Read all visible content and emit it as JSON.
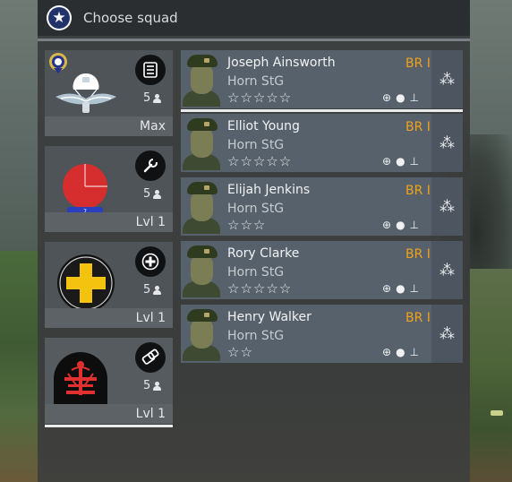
{
  "header": {
    "title": "Choose squad",
    "emblem_icon": "star-roundel-icon"
  },
  "squads": [
    {
      "role_icon": "list-icon",
      "emblem": "parachute-wings-badge",
      "count": "5",
      "level": "Max",
      "selected": false
    },
    {
      "role_icon": "wrench-icon",
      "emblem": "red-circle-badge",
      "count": "5",
      "level": "Lvl 1",
      "selected": false
    },
    {
      "role_icon": "medic-cross-icon",
      "emblem": "yellow-cross-badge",
      "count": "5",
      "level": "Lvl 1",
      "selected": false
    },
    {
      "role_icon": "grenade-icon",
      "emblem": "red-insignia-badge",
      "count": "5",
      "level": "Lvl 1",
      "selected": true
    }
  ],
  "soldiers": [
    {
      "name": "Joseph Ainsworth",
      "weapon": "Horn StG",
      "br": "BR I",
      "stars": "☆☆☆☆☆",
      "selected": true
    },
    {
      "name": "Elliot Young",
      "weapon": "Horn StG",
      "br": "BR I",
      "stars": "☆☆☆☆☆",
      "selected": false
    },
    {
      "name": "Elijah Jenkins",
      "weapon": "Horn StG",
      "br": "BR I",
      "stars": "☆☆☆",
      "selected": false
    },
    {
      "name": "Rory Clarke",
      "weapon": "Horn StG",
      "br": "BR I",
      "stars": "☆☆☆☆☆",
      "selected": false
    },
    {
      "name": "Henry Walker",
      "weapon": "Horn StG",
      "br": "BR I",
      "stars": "☆☆",
      "selected": false
    }
  ],
  "soldier_stat_icons": [
    "medkit-icon",
    "grenade-icon",
    "flask-icon"
  ],
  "soldier_role_icon": "grenades-icon",
  "colors": {
    "accent_br": "#f0a21b",
    "emblem_blue": "#22336a"
  }
}
